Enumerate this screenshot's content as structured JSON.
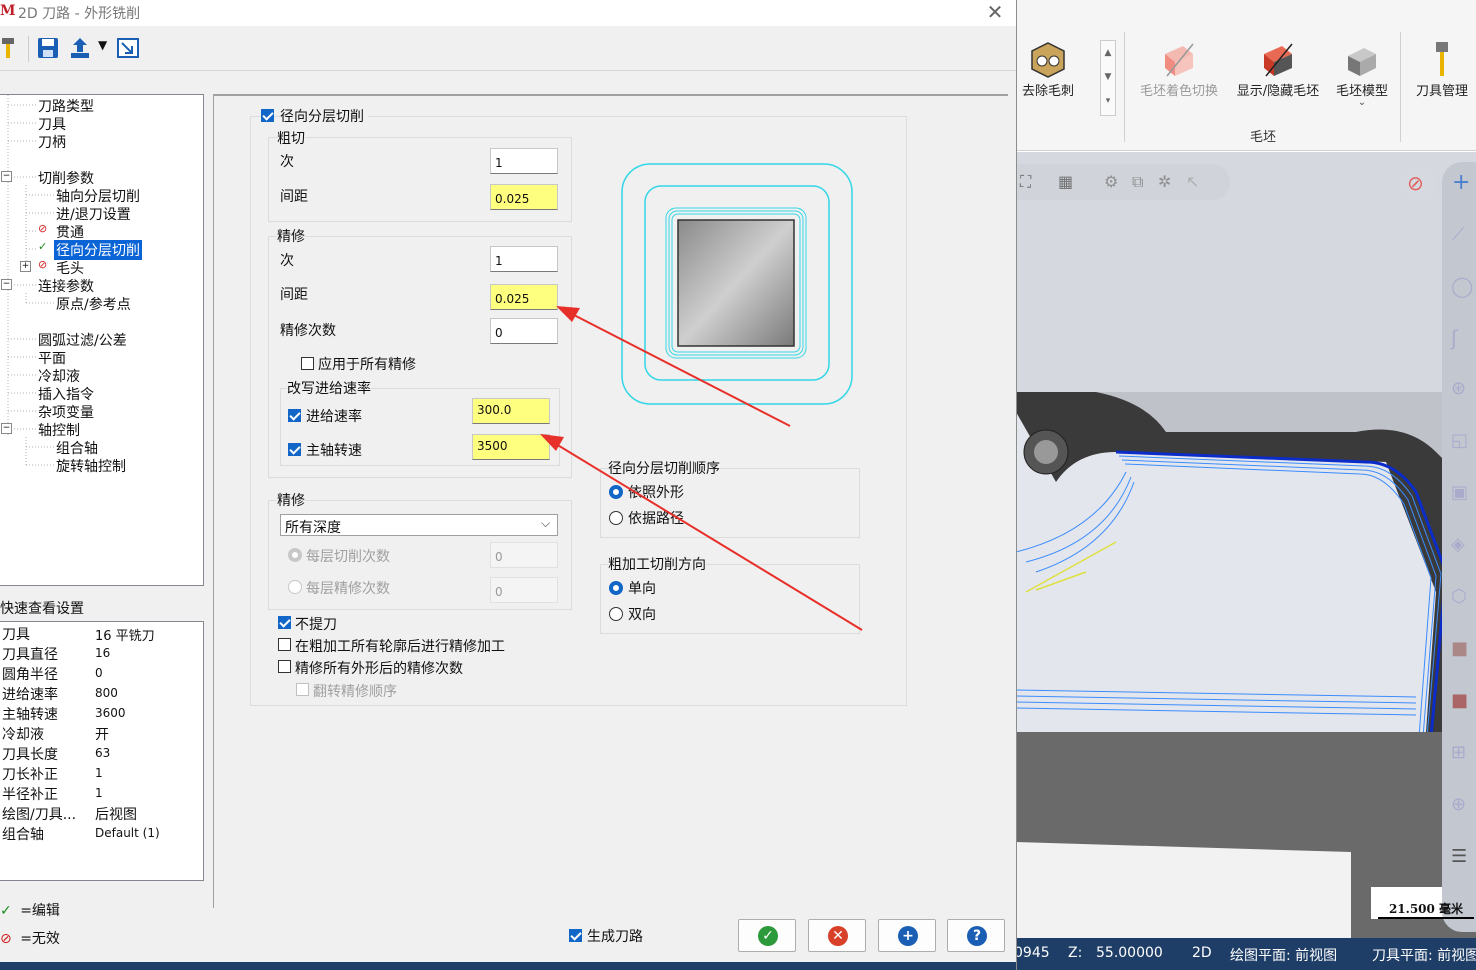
{
  "window": {
    "title": "2D 刀路 - 外形铣削",
    "close_glyph": "✕"
  },
  "tree": {
    "items": [
      {
        "label": "刀路类型",
        "mark": ""
      },
      {
        "label": "刀具",
        "mark": ""
      },
      {
        "label": "刀柄",
        "mark": ""
      },
      {
        "label": "切削参数",
        "mark": ""
      },
      {
        "label": "轴向分层切削",
        "mark": ""
      },
      {
        "label": "进/退刀设置",
        "mark": ""
      },
      {
        "label": "贯通",
        "mark": "invalid"
      },
      {
        "label": "径向分层切削",
        "mark": "edit"
      },
      {
        "label": "毛头",
        "mark": "invalid"
      },
      {
        "label": "连接参数",
        "mark": ""
      },
      {
        "label": "原点/参考点",
        "mark": ""
      },
      {
        "label": "圆弧过滤/公差",
        "mark": ""
      },
      {
        "label": "平面",
        "mark": ""
      },
      {
        "label": "冷却液",
        "mark": ""
      },
      {
        "label": "插入指令",
        "mark": ""
      },
      {
        "label": "杂项变量",
        "mark": ""
      },
      {
        "label": "轴控制",
        "mark": ""
      },
      {
        "label": "组合轴",
        "mark": ""
      },
      {
        "label": "旋转轴控制",
        "mark": ""
      }
    ]
  },
  "quick_view": {
    "title": "快速查看设置",
    "rows": [
      {
        "key": "刀具",
        "value": "16 平铣刀"
      },
      {
        "key": "刀具直径",
        "value": "16"
      },
      {
        "key": "圆角半径",
        "value": "0"
      },
      {
        "key": "进给速率",
        "value": "800"
      },
      {
        "key": "主轴转速",
        "value": "3600"
      },
      {
        "key": "冷却液",
        "value": "开"
      },
      {
        "key": "刀具长度",
        "value": "63"
      },
      {
        "key": "刀长补正",
        "value": "1"
      },
      {
        "key": "半径补正",
        "value": "1"
      },
      {
        "key": "绘图/刀具...",
        "value": "后视图"
      },
      {
        "key": "组合轴",
        "value": "Default (1)"
      }
    ]
  },
  "legend": {
    "edit": "=编辑",
    "invalid": "=无效",
    "edit_glyph": "✓",
    "invalid_glyph": "⊘"
  },
  "radial": {
    "enable_label": "径向分层切削",
    "rough": {
      "title": "粗切",
      "count_label": "次",
      "count": "1",
      "spacing_label": "间距",
      "spacing": "0.025"
    },
    "finish": {
      "title": "精修",
      "count_label": "次",
      "count": "1",
      "spacing_label": "间距",
      "spacing": "0.025",
      "passes_label": "精修次数",
      "passes": "0",
      "apply_all_label": "应用于所有精修",
      "override": {
        "title": "改写进给速率",
        "feed_label": "进给速率",
        "feed": "300.0",
        "spindle_label": "主轴转速",
        "spindle": "3500"
      }
    },
    "finish_depth": {
      "title": "精修",
      "select_value": "所有深度",
      "per_layer_cut_label": "每层切削次数",
      "per_layer_cut": "0",
      "per_layer_finish_label": "每层精修次数",
      "per_layer_finish": "0"
    },
    "no_lift_label": "不提刀",
    "finish_after_rough_label": "在粗加工所有轮廓后进行精修加工",
    "finish_all_count_label": "精修所有外形后的精修次数",
    "reverse_finish_label": "翻转精修顺序",
    "order": {
      "title": "径向分层切削顺序",
      "opt1": "依照外形",
      "opt2": "依据路径"
    },
    "direction": {
      "title": "粗加工切削方向",
      "opt1": "单向",
      "opt2": "双向"
    }
  },
  "footer": {
    "generate_label": "生成刀路"
  },
  "ribbon": {
    "remove_burr": "去除毛刺",
    "stock_shade": "毛坯着色切换",
    "show_hide_stock": "显示/隐藏毛坯",
    "stock_model": "毛坯模型",
    "tool_manage": "刀具管理",
    "group_stock": "毛坯"
  },
  "viewport": {
    "scale_text": "21.500 毫米"
  },
  "status": {
    "coord_partial": "0945",
    "z_label": "Z:",
    "z_value": "55.00000",
    "mode": "2D",
    "drawing_plane": "绘图平面: 前视图",
    "tool_plane": "刀具平面: 前视图"
  },
  "colors": {
    "accent": "#1266c8",
    "highlight_input": "#ffff7f",
    "selection": "#0a64d6",
    "arrow": "#e8302a",
    "toolpath": "#1a6fff",
    "status_bg": "#1f3e67"
  }
}
